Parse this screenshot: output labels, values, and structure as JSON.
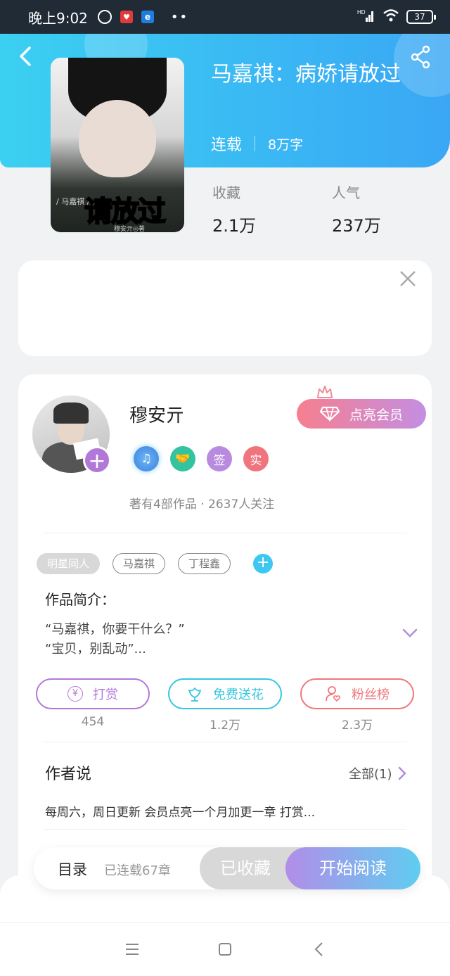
{
  "status_bar": {
    "time": "晚上9:02",
    "network": "HD",
    "battery": "37",
    "dots": "••"
  },
  "book": {
    "title": "马嘉祺：病娇请放过",
    "status": "连载",
    "word_count": "8万字",
    "cover_text": "请放过",
    "cover_small_text": "/ 马嘉祺 /",
    "cover_author_text": "穆安亓◎著"
  },
  "stats": {
    "favorites_label": "收藏",
    "favorites_value": "2.1万",
    "popularity_label": "人气",
    "popularity_value": "237万"
  },
  "author": {
    "name": "穆安亓",
    "works": "著有4部作品 · 2637人关注",
    "vip_label": "点亮会员",
    "badges": {
      "sign": "签",
      "real": "实"
    }
  },
  "tags": {
    "genre": "明星同人",
    "items": [
      "马嘉祺",
      "丁程鑫"
    ]
  },
  "intro": {
    "title": "作品简介：",
    "line1": "“马嘉祺，你要干什么？”",
    "line2": "“宝贝，别乱动”..."
  },
  "actions": {
    "reward_label": "打赏",
    "reward_count": "454",
    "flower_label": "免费送花",
    "flower_count": "1.2万",
    "fans_label": "粉丝榜",
    "fans_count": "2.3万",
    "yen_symbol": "¥"
  },
  "author_says": {
    "title": "作者说",
    "all_label": "全部(1)",
    "text": "每周六，周日更新 会员点亮一个月加更一章 打赏..."
  },
  "bottom": {
    "toc_label": "目录",
    "toc_count": "已连载67章",
    "collected_label": "已收藏",
    "read_label": "开始阅读"
  },
  "colors": {
    "header_start": "#3bd0f1",
    "header_end": "#3aa7f5",
    "vip_start": "#f67f8f",
    "vip_end": "#c48ee2",
    "reward": "#b278d8",
    "flower": "#36c6e0",
    "fans": "#f0767c"
  }
}
